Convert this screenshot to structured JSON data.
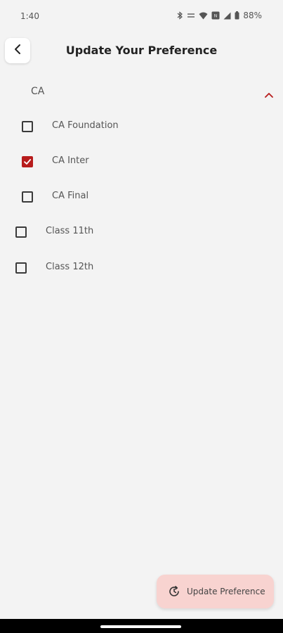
{
  "status_bar": {
    "time": "1:40",
    "battery": "88%",
    "icons": [
      "bluetooth-icon",
      "data-speed-icon",
      "wifi-icon",
      "nfc-icon",
      "signal-icon",
      "battery-icon"
    ]
  },
  "header": {
    "title": "Update Your Preference",
    "back_icon": "back-arrow-icon"
  },
  "section": {
    "label": "CA",
    "expanded": true,
    "accent_color": "#b71c1c",
    "items": [
      {
        "label": "CA Foundation",
        "checked": false
      },
      {
        "label": "CA Inter",
        "checked": true
      },
      {
        "label": "CA Final",
        "checked": false
      }
    ]
  },
  "other_items": [
    {
      "label": "Class 11th",
      "checked": false
    },
    {
      "label": "Class 12th",
      "checked": false
    }
  ],
  "action_button": {
    "label": "Update Preference",
    "icon": "refresh-clock-icon",
    "background": "#f8d3d0"
  }
}
